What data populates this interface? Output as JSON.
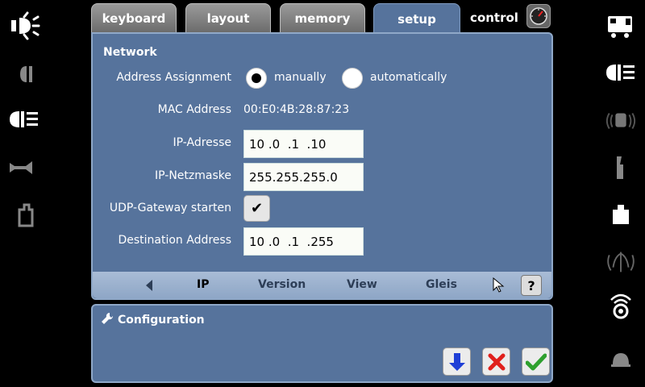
{
  "tabs": [
    {
      "label": "keyboard"
    },
    {
      "label": "layout"
    },
    {
      "label": "memory"
    },
    {
      "label": "setup"
    },
    {
      "label": "control"
    }
  ],
  "network": {
    "title": "Network",
    "address_assignment": {
      "label": "Address Assignment",
      "option_manual": "manually",
      "option_auto": "automatically",
      "selected": "manually"
    },
    "mac": {
      "label": "MAC Address",
      "value": "00:E0:4B:28:87:23"
    },
    "ip": {
      "label": "IP-Adresse",
      "value": "10 .0  .1  .10"
    },
    "netmask": {
      "label": "IP-Netzmaske",
      "value": "255.255.255.0"
    },
    "udp": {
      "label": "UDP-Gateway starten",
      "checked": true
    },
    "destination": {
      "label": "Destination Address",
      "value": "10 .0  .1  .255"
    }
  },
  "subtabs": [
    {
      "label": "IP"
    },
    {
      "label": "Version"
    },
    {
      "label": "View"
    },
    {
      "label": "Gleis"
    }
  ],
  "help_label": "?",
  "config": {
    "title": "Configuration"
  },
  "colors": {
    "panel": "#56739c",
    "panel_border": "#8fa8c8",
    "subbar": "#a9bcd6",
    "ok_green": "#2ea02e",
    "cancel_red": "#e0201c",
    "down_blue": "#1f3fd6"
  }
}
